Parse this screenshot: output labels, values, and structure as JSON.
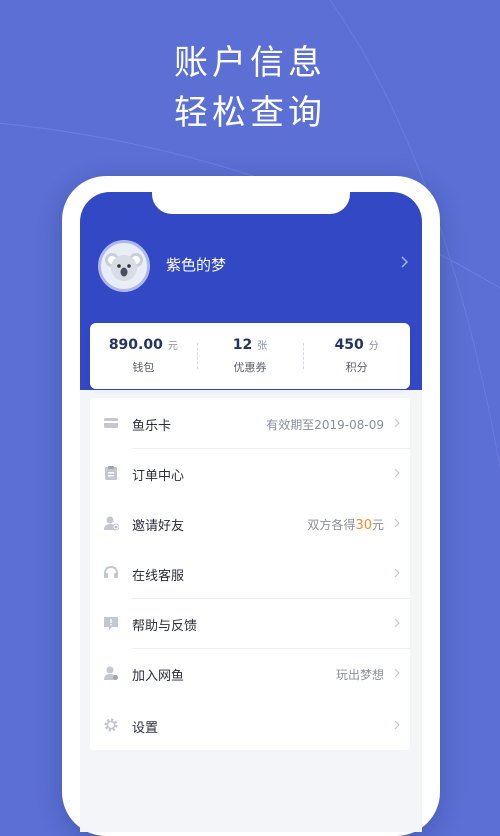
{
  "headline": {
    "line1": "账户信息",
    "line2": "轻松查询"
  },
  "colors": {
    "background": "#5b6fd4",
    "header_blue": "#3348c4",
    "accent_orange": "#f08a24"
  },
  "profile": {
    "name": "紫色的梦",
    "avatar_icon": "koala-avatar-icon"
  },
  "stats": [
    {
      "value": "890.00",
      "unit": "元",
      "label": "钱包"
    },
    {
      "value": "12",
      "unit": "张",
      "label": "优惠券"
    },
    {
      "value": "450",
      "unit": "分",
      "label": "积分"
    }
  ],
  "menu": [
    {
      "icon": "card-icon",
      "label": "鱼乐卡",
      "value_prefix": "有效期至2019-08-09",
      "value_highlight": "",
      "value_suffix": ""
    },
    {
      "icon": "clipboard-icon",
      "label": "订单中心",
      "value_prefix": "",
      "value_highlight": "",
      "value_suffix": ""
    },
    {
      "icon": "user-add-icon",
      "label": "邀请好友",
      "value_prefix": "双方各得",
      "value_highlight": "30",
      "value_suffix": "元"
    },
    {
      "icon": "headset-icon",
      "label": "在线客服",
      "value_prefix": "",
      "value_highlight": "",
      "value_suffix": ""
    },
    {
      "icon": "feedback-icon",
      "label": "帮助与反馈",
      "value_prefix": "",
      "value_highlight": "",
      "value_suffix": ""
    },
    {
      "icon": "user-join-icon",
      "label": "加入网鱼",
      "value_prefix": "玩出梦想",
      "value_highlight": "",
      "value_suffix": ""
    },
    {
      "icon": "gear-icon",
      "label": "设置",
      "value_prefix": "",
      "value_highlight": "",
      "value_suffix": ""
    }
  ]
}
